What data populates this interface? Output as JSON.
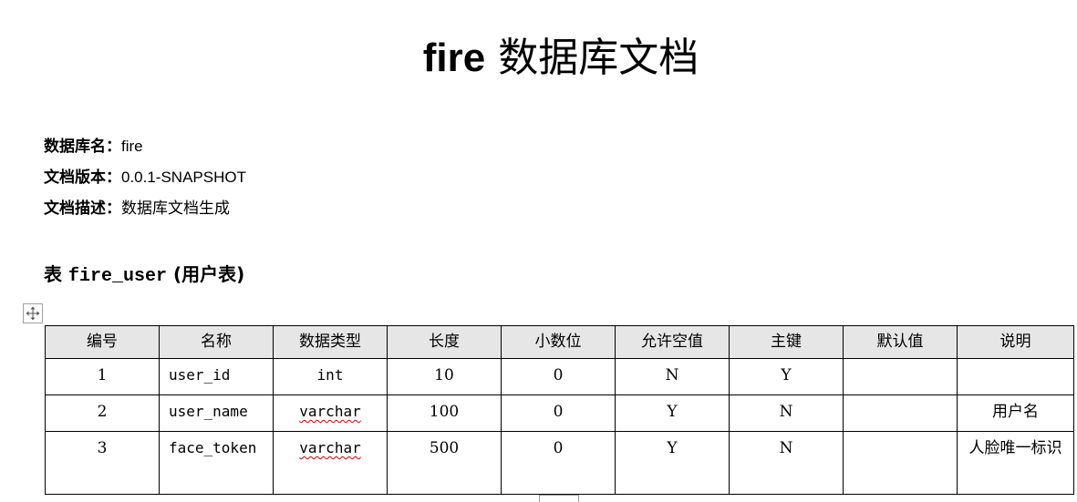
{
  "title": {
    "en": "fire",
    "cn": "数据库文档"
  },
  "meta": [
    {
      "label": "数据库名：",
      "value": "fire"
    },
    {
      "label": "文档版本：",
      "value": "0.0.1-SNAPSHOT"
    },
    {
      "label": "文档描述：",
      "value": "数据库文档生成"
    }
  ],
  "table_heading": {
    "prefix": "表 ",
    "name": "fire_user",
    "suffix": " (用户表)"
  },
  "table": {
    "headers": [
      "编号",
      "名称",
      "数据类型",
      "长度",
      "小数位",
      "允许空值",
      "主键",
      "默认值",
      "说明"
    ],
    "rows": [
      {
        "no": "1",
        "name": "user_id",
        "type": "int",
        "length": "10",
        "scale": "0",
        "nullable": "N",
        "pk": "Y",
        "default": "",
        "comment": ""
      },
      {
        "no": "2",
        "name": "user_name",
        "type": "varchar",
        "length": "100",
        "scale": "0",
        "nullable": "Y",
        "pk": "N",
        "default": "",
        "comment": "用户名"
      },
      {
        "no": "3",
        "name": "face_token",
        "type": "varchar",
        "length": "500",
        "scale": "0",
        "nullable": "Y",
        "pk": "N",
        "default": "",
        "comment": "人脸唯一标识"
      }
    ]
  },
  "icons": {
    "table_move_handle": "move-arrows-icon"
  }
}
